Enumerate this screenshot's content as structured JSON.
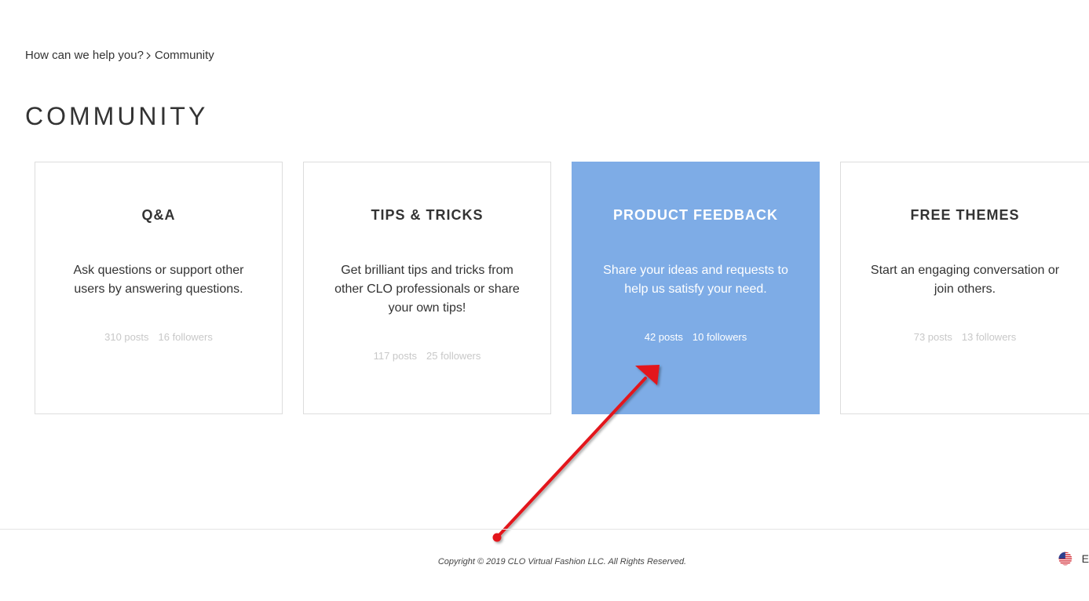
{
  "breadcrumb": {
    "home": "How can we help you?",
    "current": "Community"
  },
  "page_title": "COMMUNITY",
  "cards": [
    {
      "title": "Q&A",
      "description": "Ask questions or support other users by answering questions.",
      "posts": "310 posts",
      "followers": "16 followers"
    },
    {
      "title": "TIPS & TRICKS",
      "description": "Get brilliant tips and tricks from other CLO professionals or share your own tips!",
      "posts": "117 posts",
      "followers": "25 followers"
    },
    {
      "title": "PRODUCT FEEDBACK",
      "description": "Share your ideas and requests to help us satisfy your need.",
      "posts": "42 posts",
      "followers": "10 followers"
    },
    {
      "title": "FREE THEMES",
      "description": "Start an engaging conversation or join others.",
      "posts": "73 posts",
      "followers": "13 followers"
    }
  ],
  "footer": {
    "copyright": "Copyright © 2019 CLO Virtual Fashion LLC. All Rights Reserved.",
    "language": "E",
    "language_icon": "us-flag-icon"
  },
  "colors": {
    "active_card": "#7eace6",
    "annotation_arrow": "#e3151a"
  }
}
